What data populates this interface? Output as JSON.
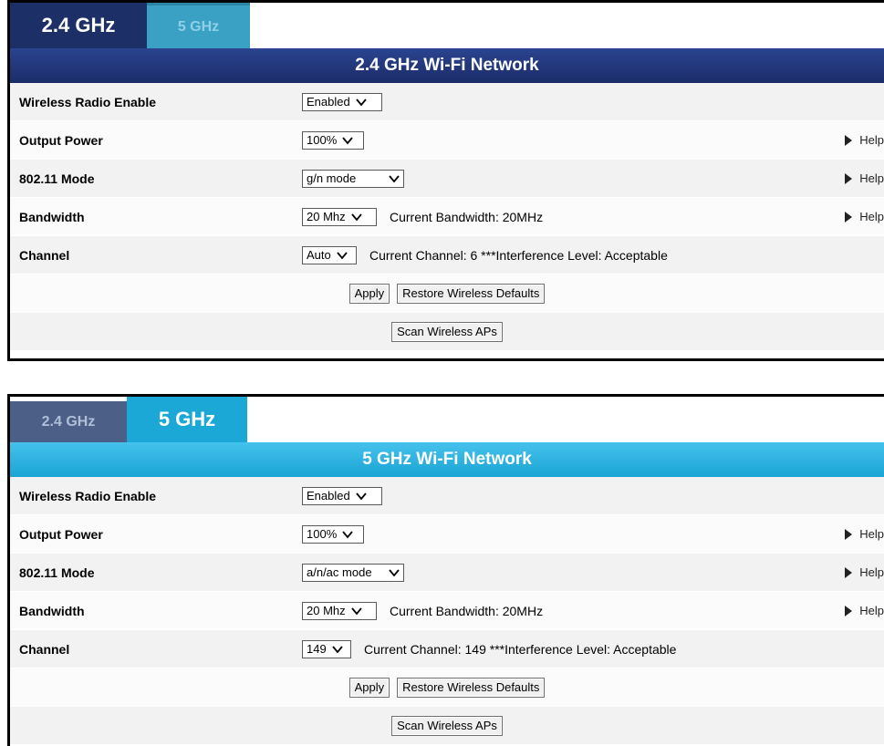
{
  "panel_24": {
    "tab_active": "2.4 GHz",
    "tab_other": "5 GHz",
    "header": "2.4 GHz Wi-Fi Network",
    "rows": {
      "radio": {
        "label": "Wireless Radio Enable",
        "value": "Enabled"
      },
      "power": {
        "label": "Output Power",
        "value": "100%",
        "help": "Help"
      },
      "mode": {
        "label": "802.11 Mode",
        "value": "g/n mode",
        "help": "Help"
      },
      "bandwidth": {
        "label": "Bandwidth",
        "value": "20 Mhz",
        "info": "Current Bandwidth: 20MHz",
        "help": "Help"
      },
      "channel": {
        "label": "Channel",
        "value": "Auto",
        "info": "Current Channel: 6 ***Interference Level: Acceptable"
      }
    },
    "buttons": {
      "apply": "Apply",
      "restore": "Restore Wireless Defaults",
      "scan": "Scan Wireless APs"
    }
  },
  "panel_5": {
    "tab_other": "2.4 GHz",
    "tab_active": "5 GHz",
    "header": "5 GHz Wi-Fi Network",
    "rows": {
      "radio": {
        "label": "Wireless Radio Enable",
        "value": "Enabled"
      },
      "power": {
        "label": "Output Power",
        "value": "100%",
        "help": "Help"
      },
      "mode": {
        "label": "802.11 Mode",
        "value": "a/n/ac mode",
        "help": "Help"
      },
      "bandwidth": {
        "label": "Bandwidth",
        "value": "20 Mhz",
        "info": "Current Bandwidth: 20MHz",
        "help": "Help"
      },
      "channel": {
        "label": "Channel",
        "value": "149",
        "info": "Current Channel: 149 ***Interference Level: Acceptable"
      }
    },
    "buttons": {
      "apply": "Apply",
      "restore": "Restore Wireless Defaults",
      "scan": "Scan Wireless APs"
    }
  },
  "icons": {
    "dropdown": "chevron-down-icon",
    "help": "triangle-right-icon"
  },
  "colors": {
    "tab_24_active": "#1c2f66",
    "tab_5_active": "#1ba8d6",
    "header_24": "#1f3373",
    "header_5": "#28b2e0"
  }
}
